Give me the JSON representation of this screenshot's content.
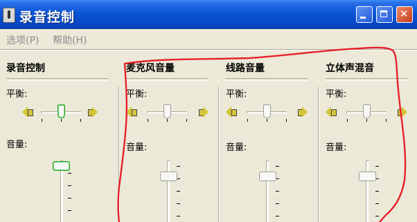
{
  "window": {
    "title": "录音控制",
    "icon": "microphone-app-icon"
  },
  "menu": {
    "options": "选项(P)",
    "help": "帮助(H)"
  },
  "columns": [
    {
      "id": "record-control",
      "title": "录音控制",
      "balance_label": "平衡:",
      "volume_label": "音量:",
      "balance": 0.5,
      "volume": 1.0,
      "selected": true
    },
    {
      "id": "microphone-volume",
      "title": "麦克风音量",
      "balance_label": "平衡:",
      "volume_label": "音量:",
      "balance": 0.5,
      "volume": 0.8,
      "selected": false
    },
    {
      "id": "line-volume",
      "title": "线路音量",
      "balance_label": "平衡:",
      "volume_label": "音量:",
      "balance": 0.5,
      "volume": 0.8,
      "selected": false
    },
    {
      "id": "stereo-mix",
      "title": "立体声混音",
      "balance_label": "平衡:",
      "volume_label": "音量:",
      "balance": 0.5,
      "volume": 0.8,
      "selected": false
    }
  ],
  "colors": {
    "titlebar": "#0a55d6",
    "face": "#ece9d8",
    "annotation": "#e8202a",
    "focus": "#2fa12f"
  }
}
